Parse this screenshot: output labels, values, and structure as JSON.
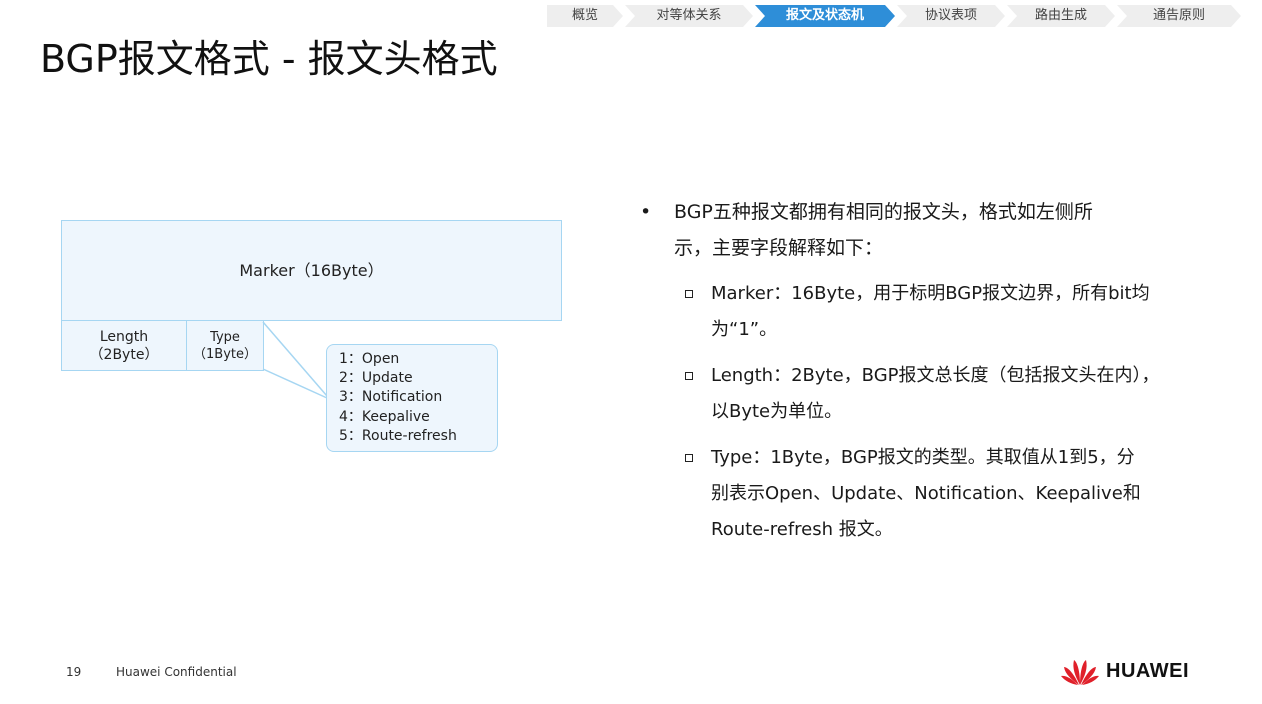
{
  "nav": {
    "tabs": [
      {
        "label": "概览",
        "active": false
      },
      {
        "label": "对等体关系",
        "active": false
      },
      {
        "label": "报文及状态机",
        "active": true
      },
      {
        "label": "协议表项",
        "active": false
      },
      {
        "label": "路由生成",
        "active": false
      },
      {
        "label": "通告原则",
        "active": false
      }
    ]
  },
  "title": "BGP报文格式 - 报文头格式",
  "diagram": {
    "marker_label": "Marker（16Byte）",
    "length_label": "Length",
    "length_size": "（2Byte）",
    "type_label": "Type",
    "type_size": "（1Byte）",
    "type_values": [
      "1：Open",
      "2：Update",
      "3：Notification",
      "4：Keepalive",
      "5：Route-refresh"
    ]
  },
  "content": {
    "main": {
      "lines": [
        "BGP五种报文都拥有相同的报文头，格式如左侧所",
        "示，主要字段解释如下："
      ]
    },
    "subs": [
      {
        "lines": [
          "Marker：16Byte，用于标明BGP报文边界，所有bit均",
          "为“1”。"
        ]
      },
      {
        "lines": [
          "Length：2Byte，BGP报文总长度（包括报文头在内），",
          "以Byte为单位。"
        ]
      },
      {
        "lines": [
          "Type：1Byte，BGP报文的类型。其取值从1到5，分",
          "别表示Open、Update、Notification、Keepalive和",
          "Route-refresh 报文。"
        ]
      }
    ]
  },
  "footer": {
    "page_number": "19",
    "confidential": "Huawei Confidential",
    "logo_text": "HUAWEI",
    "logo_color": "#e0202a"
  },
  "colors": {
    "accent": "#2e8ed8",
    "diagram_fill": "#eef6fd",
    "diagram_border": "#a6d6f2"
  }
}
